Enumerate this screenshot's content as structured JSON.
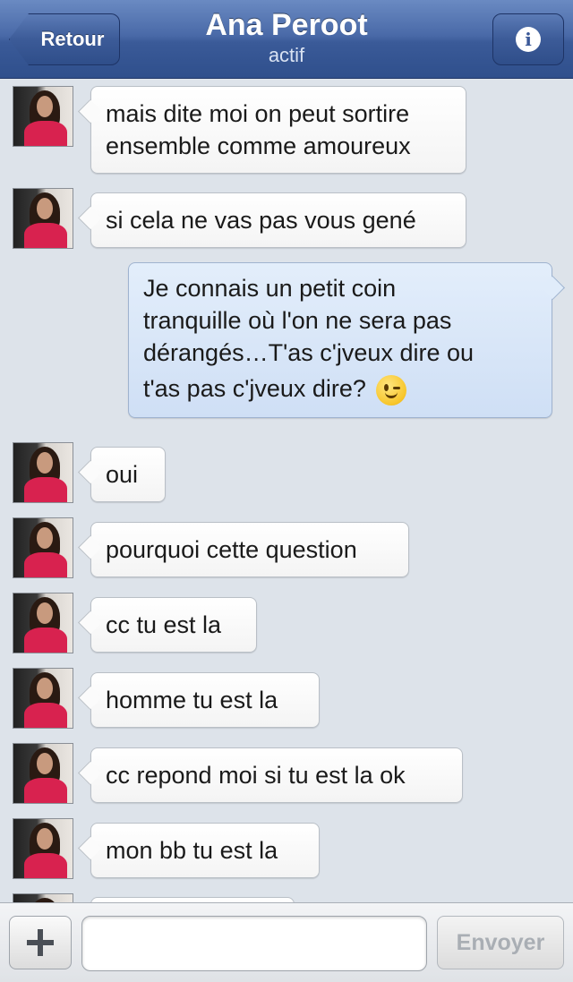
{
  "header": {
    "back_label": "Retour",
    "title": "Ana Peroot",
    "status": "actif",
    "info_icon": "info-icon"
  },
  "messages": [
    {
      "side": "left",
      "lines": [
        "mais dite moi on peut sortire",
        "ensemble comme amoureux"
      ]
    },
    {
      "side": "left",
      "lines": [
        "si cela ne vas pas vous gené"
      ]
    },
    {
      "side": "right",
      "lines": [
        "Je connais un petit coin",
        "tranquille où l'on ne sera pas",
        "dérangés…T'as c'jveux dire ou",
        "t'as pas c'jveux dire?"
      ],
      "emoji": "winking-face-icon"
    },
    {
      "side": "left",
      "lines": [
        "oui"
      ]
    },
    {
      "side": "left",
      "lines": [
        "pourquoi cette question"
      ]
    },
    {
      "side": "left",
      "lines": [
        "cc tu est la"
      ]
    },
    {
      "side": "left",
      "lines": [
        "homme tu est la"
      ]
    },
    {
      "side": "left",
      "lines": [
        "cc repond moi si tu est la ok"
      ]
    },
    {
      "side": "left",
      "lines": [
        "mon bb tu est la"
      ]
    }
  ],
  "composer": {
    "add_icon": "plus-icon",
    "input_value": "",
    "send_label": "Envoyer"
  },
  "colors": {
    "header_blue": "#3b5998",
    "outgoing_bubble": "#dbe8f8",
    "incoming_bubble": "#ffffff",
    "chat_background": "#dde3ea"
  }
}
